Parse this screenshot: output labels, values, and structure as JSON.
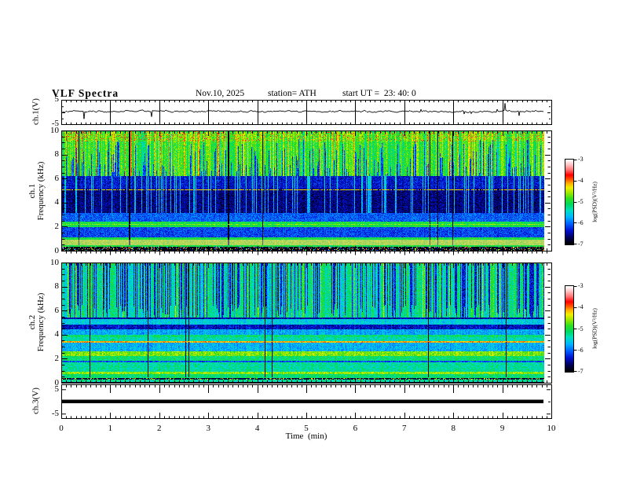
{
  "header": {
    "title": "VLF Spectra",
    "date": "Nov.10, 2025",
    "station": "station= ATH",
    "start_ut": "start UT =  23: 40: 0"
  },
  "time_axis": {
    "label": "Time  (min)",
    "min": 0,
    "max": 10,
    "ticks": [
      0,
      1,
      2,
      3,
      4,
      5,
      6,
      7,
      8,
      9,
      10
    ],
    "minor_step_min": 0.1,
    "data_end_min": 9.84
  },
  "colorbar": {
    "label": "log(PSD)(V²/Hz)",
    "ticks": [
      -3,
      -4,
      -5,
      -6,
      -7
    ],
    "min": -7,
    "max": -3,
    "stops": [
      [
        0.0,
        "#000000"
      ],
      [
        0.07,
        "#000050"
      ],
      [
        0.16,
        "#0010d0"
      ],
      [
        0.24,
        "#0060ff"
      ],
      [
        0.32,
        "#00b4ff"
      ],
      [
        0.4,
        "#00e0c0"
      ],
      [
        0.47,
        "#00d860"
      ],
      [
        0.54,
        "#30e020"
      ],
      [
        0.61,
        "#a0e800"
      ],
      [
        0.67,
        "#f0f000"
      ],
      [
        0.72,
        "#ffb000"
      ],
      [
        0.77,
        "#ff5000"
      ],
      [
        0.82,
        "#ff0000"
      ],
      [
        0.88,
        "#ff7070"
      ],
      [
        0.94,
        "#ffc0c0"
      ],
      [
        1.0,
        "#ffffff"
      ]
    ]
  },
  "chart_data": [
    {
      "type": "line",
      "name": "ch1-waveform",
      "ylabel": "ch.1(V)",
      "ylim": [
        -5,
        5
      ],
      "yticks": [
        5,
        -5
      ],
      "xlim": [
        0,
        10
      ],
      "baseline": 0.4,
      "color": "#000000",
      "noise": {
        "wander": 0.28,
        "persistence": 0.75,
        "spike_prob": 0.022,
        "spike_max": 4.2
      },
      "description": "noisy signal near 0 V with impulsive spikes up to about +/-4.5 V"
    },
    {
      "type": "heatmap",
      "subtype": "spectrogram",
      "name": "ch1-spectrogram",
      "ylabel": [
        "ch.1",
        "Frequency  (kHz)"
      ],
      "flim": [
        0,
        10
      ],
      "yticks": [
        10,
        8,
        6,
        4,
        2,
        0
      ],
      "zlim": [
        -7,
        -3
      ],
      "bands": [
        [
          9.2,
          10.0,
          -4.75
        ],
        [
          6.3,
          9.2,
          -4.9
        ],
        [
          5.2,
          6.3,
          -6.35
        ],
        [
          3.2,
          5.2,
          -6.6
        ],
        [
          2.45,
          3.2,
          -6.05
        ],
        [
          2.0,
          2.45,
          -5.0
        ],
        [
          1.15,
          2.0,
          -6.15
        ],
        [
          0.95,
          1.15,
          -5.0
        ],
        [
          0.5,
          0.95,
          -4.55,
          0.5
        ],
        [
          0.35,
          0.5,
          -5.0
        ],
        [
          0.0,
          0.35,
          -7.0
        ]
      ],
      "hlines": [
        {
          "f": 5.15,
          "level": -4.3
        },
        {
          "f": 2.25,
          "level": -4.6
        }
      ],
      "streaks": {
        "blue_up_prob": 0.28,
        "blue_top_max": 9.4,
        "cyan_prob": 0.17,
        "bright_prob": 0.1,
        "black_prob": 0.018,
        "red_speck_prob": 0.09
      },
      "description": "green 6.5-10 kHz with red bursts near 10 kHz, dark blue 3-6.5 kHz with cyan streaks, banded structure below 3 kHz, black band 0-0.35 kHz"
    },
    {
      "type": "heatmap",
      "subtype": "spectrogram",
      "name": "ch2-spectrogram",
      "ylabel": [
        "ch.2",
        "Frequency  (kHz)"
      ],
      "flim": [
        0,
        10
      ],
      "yticks": [
        10,
        8,
        6,
        4,
        2,
        0
      ],
      "zlim": [
        -7,
        -3
      ],
      "bands": [
        [
          5.5,
          10.0,
          -5.3
        ],
        [
          5.35,
          5.5,
          -6.5
        ],
        [
          4.9,
          5.35,
          -5.55
        ],
        [
          4.5,
          4.9,
          -6.4
        ],
        [
          4.05,
          4.5,
          -5.75
        ],
        [
          3.85,
          4.05,
          -5.15
        ],
        [
          3.55,
          3.85,
          -5.35
        ],
        [
          3.42,
          3.55,
          -4.15
        ],
        [
          2.65,
          3.42,
          -5.7
        ],
        [
          2.25,
          2.65,
          -4.65
        ],
        [
          1.9,
          2.25,
          -5.15
        ],
        [
          1.72,
          1.9,
          -6.1
        ],
        [
          0.95,
          1.72,
          -5.3
        ],
        [
          0.78,
          0.95,
          -4.6
        ],
        [
          0.45,
          0.78,
          -5.15
        ],
        [
          0.28,
          0.45,
          -6.8
        ],
        [
          0.12,
          0.28,
          -5.3
        ],
        [
          0.0,
          0.12,
          -6.9
        ]
      ],
      "hlines": [
        {
          "f": 3.48,
          "level": -4.1
        }
      ],
      "streaks": {
        "dark_prob": 0.3,
        "dark_bot_min": 4.8,
        "bright_prob": 0.1,
        "black_prob": 0.012
      },
      "description": "cyan-green above 5.5 kHz with dense dark-blue vertical streaks, red line near 3.5 kHz, yellow band 2.25-2.65 kHz, dark lines below 0.45 kHz"
    },
    {
      "type": "line",
      "name": "ch3-waveform",
      "ylabel": "ch.3(V)",
      "ylim": [
        -5,
        5
      ],
      "yticks": [
        5,
        -5
      ],
      "value": 0,
      "thickness_px": 4.5,
      "color": "#000000",
      "description": "flat thick line at 0 V (channel off)"
    }
  ]
}
